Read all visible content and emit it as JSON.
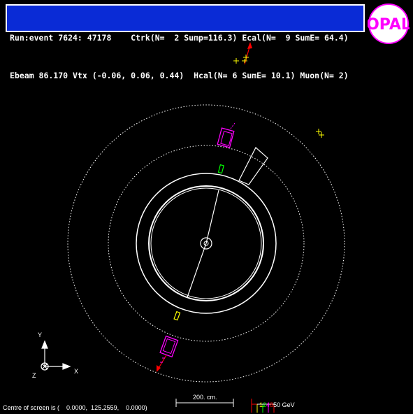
{
  "info": {
    "line1": "Run:event 7624: 47178    Ctrk(N=  2 Sump=116.3) Ecal(N=  9 SumE= 64.4)",
    "line2": "Ebeam 86.170 Vtx (-0.06, 0.06, 0.44)  Hcal(N= 6 SumE= 10.1) Muon(N= 2)"
  },
  "logo": {
    "text": "OPAL",
    "color": "#ff00ff"
  },
  "axes": {
    "y_label": "Y",
    "x_label": "X",
    "z_label": "Z"
  },
  "scale": {
    "label": "200. cm."
  },
  "energy_legend": {
    "values": [
      "1",
      "2",
      "4",
      "8",
      "50 GeV"
    ],
    "colors": [
      "#ffff00",
      "#00ff00",
      "#ff00ff",
      "#ff0000",
      "#ffffff"
    ]
  },
  "status": {
    "centre_text": "Centre of screen is (    0.0000,  125.2559,    0.0000)"
  },
  "colors": {
    "background": "#000000",
    "header_bg": "#0a2bd6",
    "track": "#ffffff",
    "muon": "#ff0000",
    "ecal": "#ff00ff",
    "hcal": "#ffff00",
    "tof": "#00ff00"
  }
}
